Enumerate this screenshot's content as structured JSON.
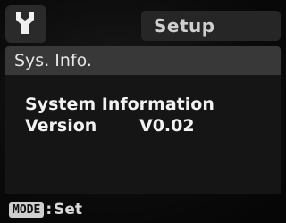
{
  "header": {
    "icon": "wrench-icon",
    "tab_label": "Setup"
  },
  "section": {
    "title": "Sys. Info."
  },
  "info": {
    "heading": "System Information",
    "version_label": "Version",
    "version_value": "V0.02"
  },
  "footer": {
    "button_label": "MODE",
    "separator": ":",
    "action_label": "Set"
  },
  "colors": {
    "background": "#070707",
    "header": "#383838",
    "panel": "#151515",
    "text": "#f2f2f2"
  }
}
